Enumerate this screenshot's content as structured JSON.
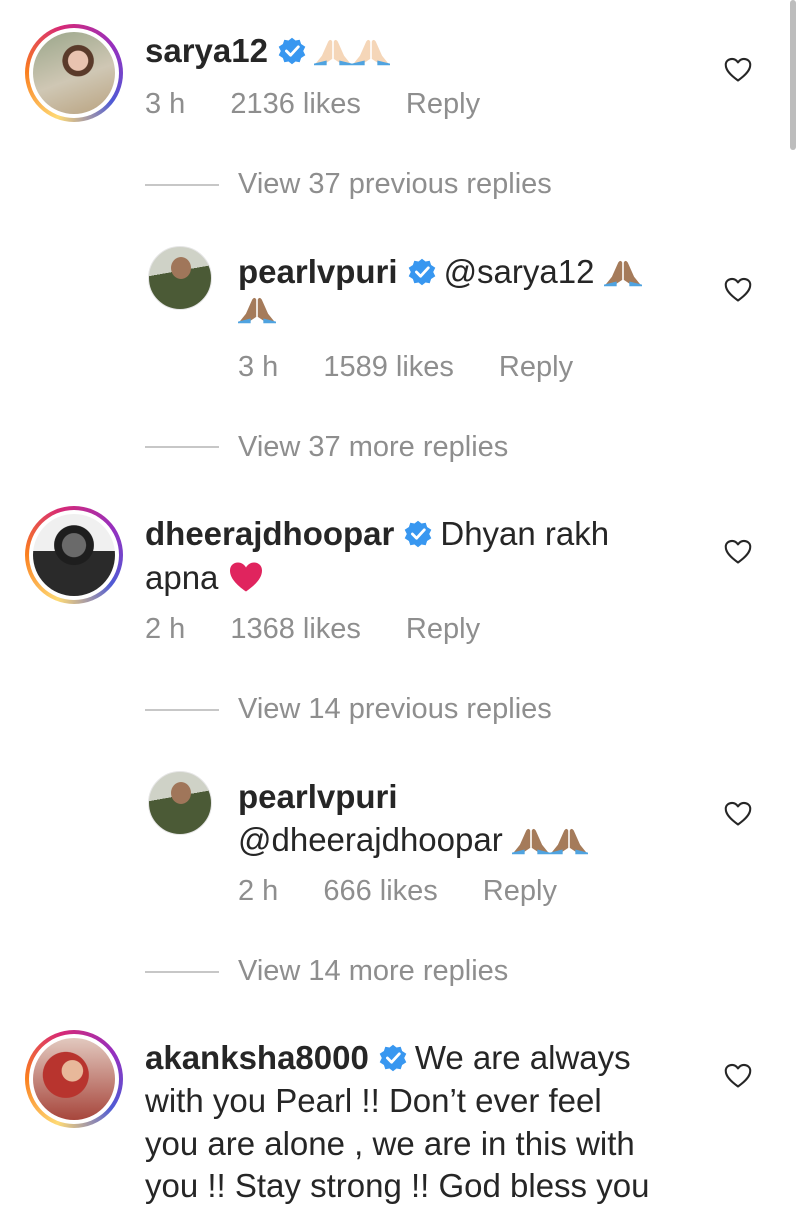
{
  "comments": [
    {
      "user": "sarya12",
      "time": "3 h",
      "likes": "2136 likes",
      "reply": "Reply"
    },
    {
      "user": "dheerajdhoopar",
      "text_line1": "Dhyan rakh",
      "text_line2": "apna",
      "time": "2 h",
      "likes": "1368 likes",
      "reply": "Reply"
    },
    {
      "user": "akanksha8000",
      "text_line1": "We are always",
      "text_line2": "with you Pearl !! Don’t ever feel",
      "text_line3": "you are alone , we are in this with",
      "text_line4": "you !! Stay strong !! God bless you"
    }
  ],
  "replies": [
    {
      "user": "pearlvpuri",
      "mention": "@sarya12",
      "time": "3 h",
      "likes": "1589 likes",
      "reply": "Reply"
    },
    {
      "user": "pearlvpuri",
      "mention": "@dheerajdhoopar",
      "time": "2 h",
      "likes": "666 likes",
      "reply": "Reply"
    }
  ],
  "view_links": [
    "View 37 previous replies",
    "View 37 more replies",
    "View 14 previous replies",
    "View 14 more replies"
  ],
  "icons": {
    "verified": "verified-badge-icon",
    "like": "heart-outline-icon",
    "emoji_pray": "folded-hands-emoji",
    "emoji_heart": "red-heart-emoji"
  },
  "colors": {
    "verified": "#3897f0",
    "muted": "#8e8e8e",
    "heart": "#e0245e"
  }
}
